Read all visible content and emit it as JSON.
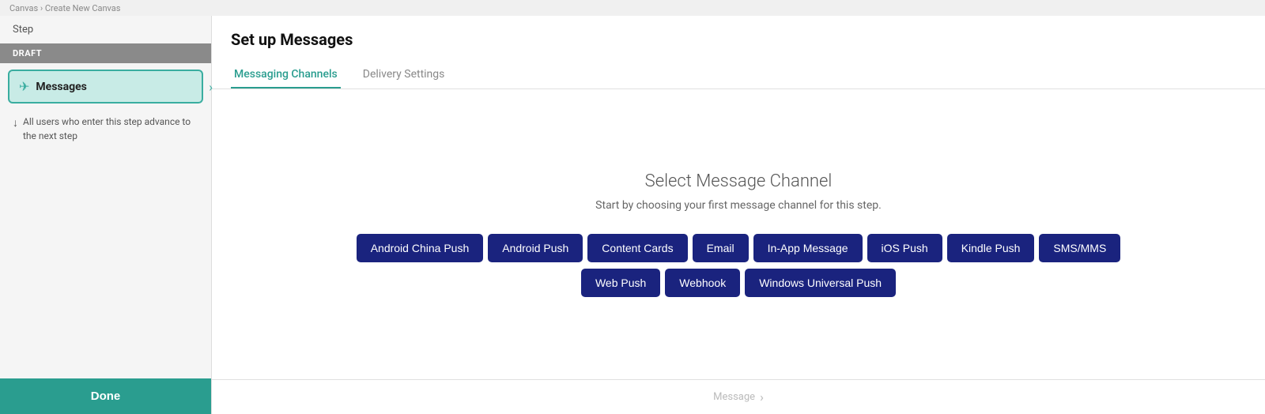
{
  "topbar": {
    "breadcrumb": "Canvas › Create New Canvas"
  },
  "sidebar": {
    "step_label": "Step",
    "draft_badge": "DRAFT",
    "messages_label": "Messages",
    "subtitle": "All users who enter this step advance to the next step",
    "done_button": "Done"
  },
  "panel": {
    "title": "Set up Messages",
    "tabs": [
      {
        "label": "Messaging Channels",
        "active": true
      },
      {
        "label": "Delivery Settings",
        "active": false
      }
    ],
    "select_title": "Select Message Channel",
    "select_subtitle": "Start by choosing your first message channel for this step.",
    "channel_row1": [
      "Android China Push",
      "Android Push",
      "Content Cards",
      "Email",
      "In-App Message",
      "iOS Push",
      "Kindle Push",
      "SMS/MMS"
    ],
    "channel_row2": [
      "Web Push",
      "Webhook",
      "Windows Universal Push"
    ],
    "footer_text": "Message"
  }
}
